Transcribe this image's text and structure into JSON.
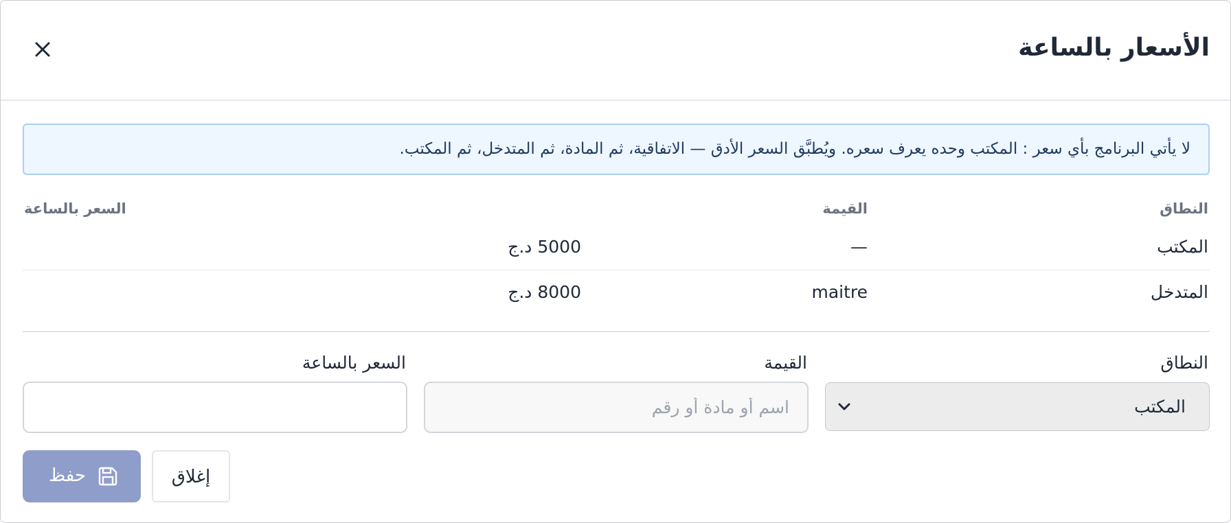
{
  "dialog": {
    "title": "الأسعار بالساعة",
    "close_icon": "close-icon"
  },
  "info_banner": {
    "text": "لا يأتي البرنامج بأي سعر : المكتب وحده يعرف سعره. ويُطبَّق السعر الأدق — الاتفاقية، ثم المادة، ثم المتدخل، ثم المكتب."
  },
  "table": {
    "headers": {
      "scope": "النطاق",
      "value": "القيمة",
      "rate": "السعر بالساعة"
    },
    "rows": [
      {
        "scope": "المكتب",
        "value": "—",
        "rate": "5000 د.ج"
      },
      {
        "scope": "المتدخل",
        "value": "maitre",
        "rate": "8000 د.ج"
      }
    ]
  },
  "form": {
    "scope_label": "النطاق",
    "scope_selected": "المكتب",
    "value_label": "القيمة",
    "value_placeholder": "اسم أو مادة أو رقم",
    "value_current": "",
    "rate_label": "السعر بالساعة",
    "rate_current": ""
  },
  "buttons": {
    "save_label": "حفظ",
    "save_icon": "save-icon",
    "close_label": "إغلاق"
  },
  "colors": {
    "save_button_bg": "#8f9dca",
    "info_bg": "#eef6ff",
    "info_border": "#a8d0f5",
    "title_text": "#1f2937"
  }
}
